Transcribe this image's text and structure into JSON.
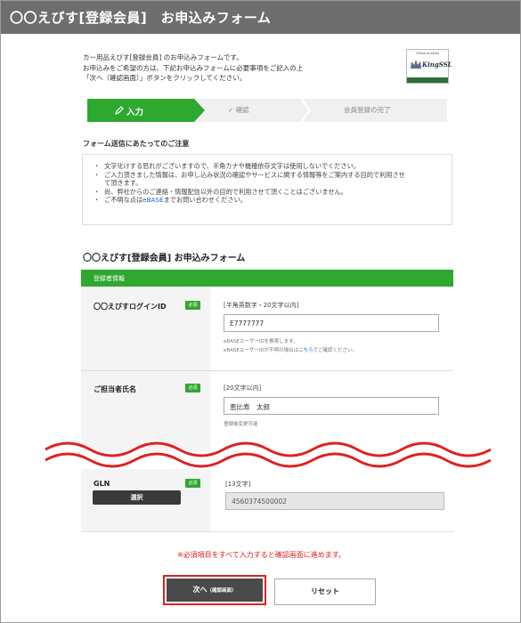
{
  "window": {
    "title": "〇〇えびす[登録会員]　お申込みフォーム"
  },
  "intro": {
    "lines": [
      "カー用品えびす[登録会員] のお申込みフォームです。",
      "お申込みをご希望の方は、下記お申込みフォームに必要事項をご記入の上",
      "「次へ（確認画面）」ボタンをクリックしてください。"
    ]
  },
  "ssl_badge": {
    "top": "256bit enabled",
    "brand": "KingSSL",
    "url": "www.kingssl.com"
  },
  "steps": {
    "step1": "入力",
    "step2": "確認",
    "step3": "会員登録の完了"
  },
  "notice": {
    "heading": "フォーム送信にあたってのご注意",
    "items": [
      "文字化けする恐れがございますので、半角カナや機種依存文字は使用しないでください。",
      "ご入力頂きました情報は、お申し込み状況の確認やサービスに関する情報等をご案内する目的で利用させ",
      "て頂きます。",
      "尚、弊社からのご連絡・情報配信以外の目的で利用させて頂くことはございません。"
    ],
    "contact_pre": "ご不明な点は",
    "contact_link": "eBASE",
    "contact_post": "までお問い合わせください。"
  },
  "form": {
    "title": "〇〇えびす[登録会員] お申込みフォーム",
    "section": "登録者情報",
    "required_badge": "必須",
    "login_id": {
      "label": "〇〇えびすログインID",
      "hint": "[半角英数字・20文字以内]",
      "value": "E7777777",
      "note1": "eBASEユーザーIDを推奨します。",
      "note2_pre": "eBASEユーザーIDが不明の場合は",
      "note2_link": "こちら",
      "note2_post": "でご確認ください。"
    },
    "contact_name": {
      "label": "ご担当者氏名",
      "hint": "[20文字以内]",
      "value": "恵比寿　太郎",
      "note": "登録後変更可能"
    },
    "gln": {
      "label": "GLN",
      "hint": "[13文字]",
      "value": "4560374500002",
      "select_button": "選択"
    }
  },
  "footer": {
    "required_note": "※必須項目をすべて入力すると確認画面に進めます。",
    "next_button": "次へ",
    "next_button_sub": "（確認画面）",
    "reset_button": "リセット"
  },
  "colors": {
    "green": "#2fa82f",
    "titlebar": "#6e6e6e",
    "alert_red": "#e02020",
    "link_blue": "#1a5ec8"
  }
}
